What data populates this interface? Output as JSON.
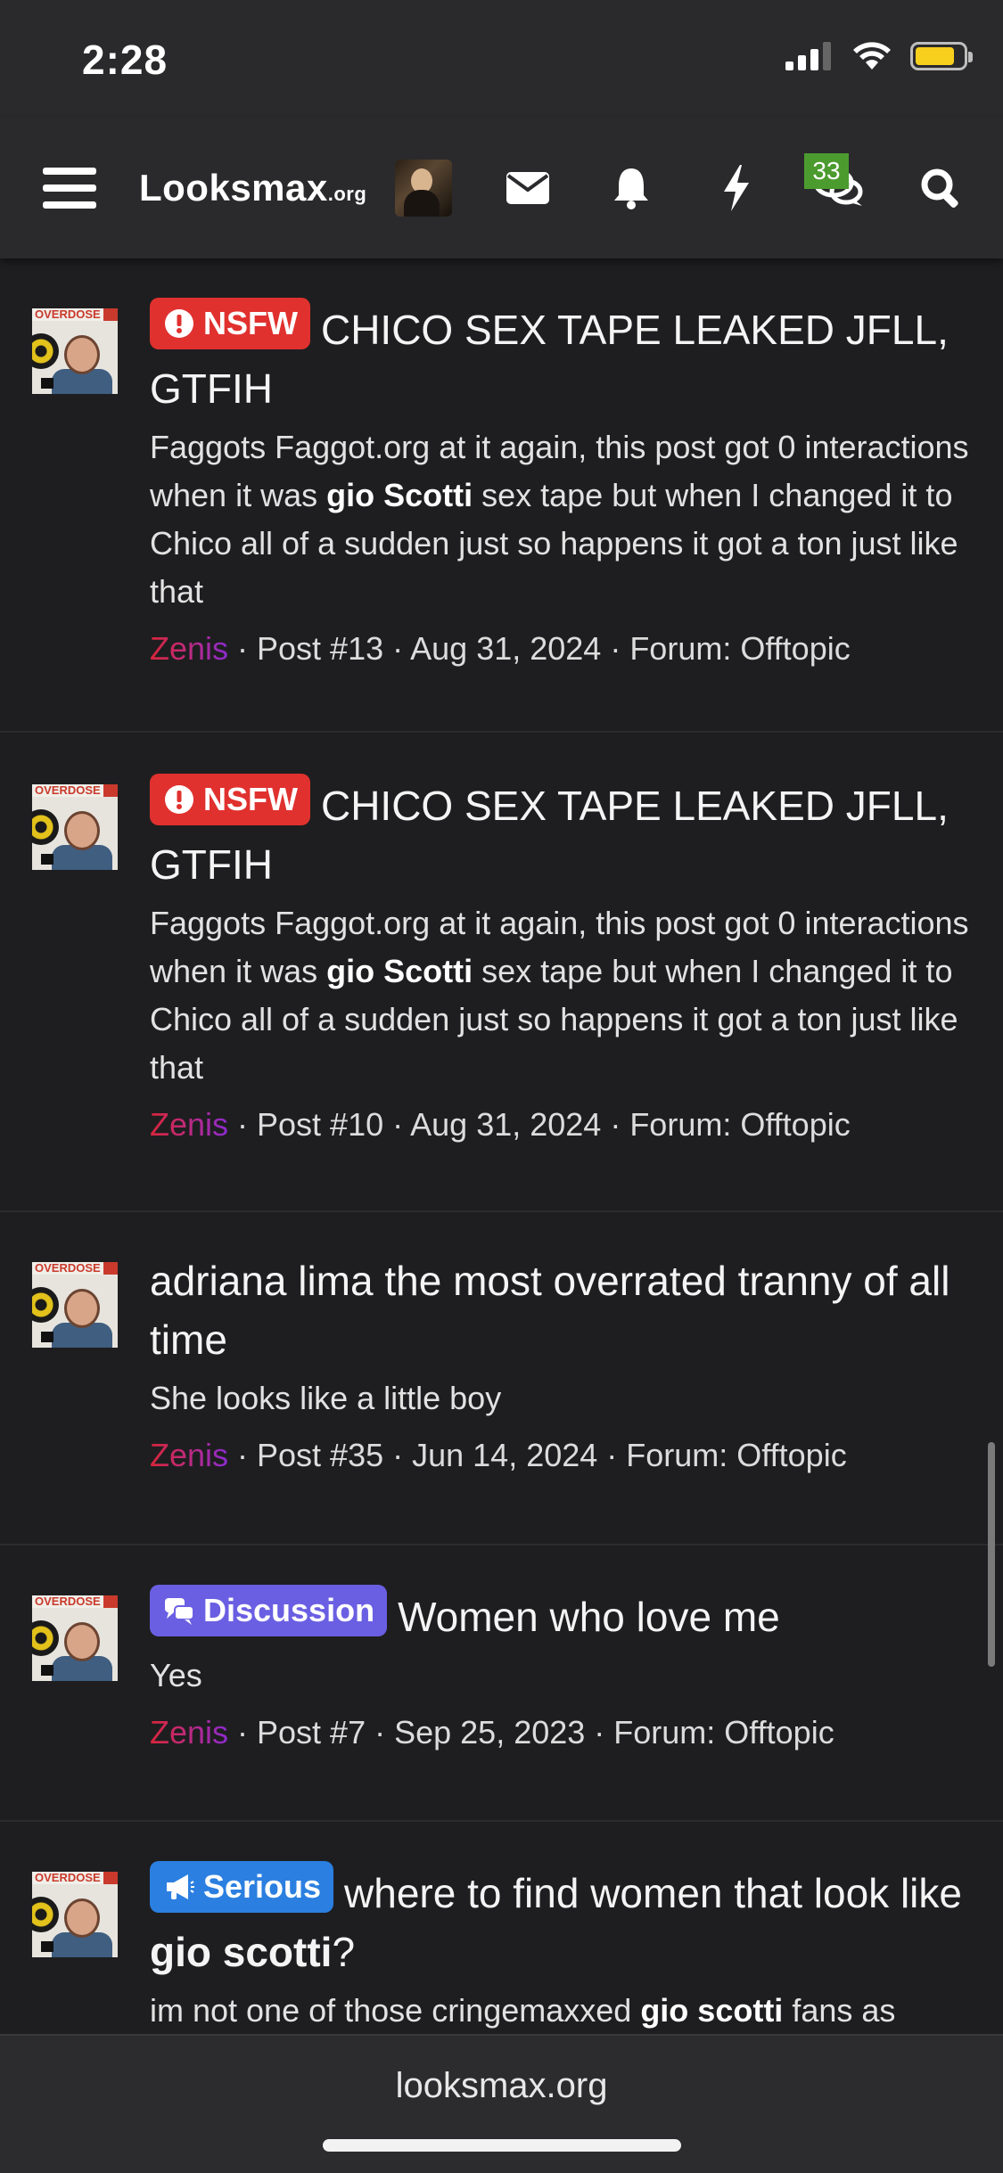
{
  "status_bar": {
    "time": "2:28",
    "battery_level": 0.85,
    "icons": [
      "cellular-icon",
      "wifi-icon",
      "battery-icon"
    ]
  },
  "nav": {
    "logo_main": "Looksmax",
    "logo_suffix": ".org",
    "messages_badge": "33",
    "icons": [
      "menu-icon",
      "avatar",
      "mail-icon",
      "bell-icon",
      "lightning-icon",
      "messages-icon",
      "search-icon"
    ]
  },
  "results": [
    {
      "badge": "NSFW",
      "title": "CHICO SEX TAPE LEAKED JFLL, GTFIH",
      "snippet_parts": [
        "Faggots Faggot.org at it again, this post got 0 interactions when it was ",
        "gio Scotti",
        " sex tape but when I changed it to Chico all of a sudden just so happens it got a ton just like that"
      ],
      "user": "Zenis",
      "meta": " · Post #13 · Aug 31, 2024 · Forum: Offtopic",
      "avatar_label": "OVERDOSE"
    },
    {
      "badge": "NSFW",
      "title": "CHICO SEX TAPE LEAKED JFLL, GTFIH",
      "snippet_parts": [
        "Faggots Faggot.org at it again, this post got 0 interactions when it was ",
        "gio Scotti",
        " sex tape but when I changed it to Chico all of a sudden just so happens it got a ton just like that"
      ],
      "user": "Zenis",
      "meta": " · Post #10 · Aug 31, 2024 · Forum: Offtopic",
      "avatar_label": "OVERDOSE"
    },
    {
      "title": "adriana lima the most overrated tranny of all time",
      "snippet": "She looks like a little boy",
      "user": "Zenis",
      "meta": " · Post #35 · Jun 14, 2024 · Forum: Offtopic",
      "avatar_label": "OVERDOSE"
    },
    {
      "badge": "Discussion",
      "title": "Women who love me",
      "snippet": "Yes",
      "user": "Zenis",
      "meta": " · Post #7 · Sep 25, 2023 · Forum: Offtopic",
      "avatar_label": "OVERDOSE"
    },
    {
      "badge": "Serious",
      "title_parts": [
        "where to find women that look like ",
        "gio scotti",
        "?"
      ],
      "snippet_parts": [
        "im not one of those cringemaxxed ",
        "gio scotti",
        " fans as"
      ],
      "avatar_label": "OVERDOSE"
    }
  ],
  "bottom_bar": {
    "url": "looksmax.org"
  },
  "colors": {
    "background": "#1e1e20",
    "header": "#2a2a2c",
    "nsfw_badge": "#e0312f",
    "discussion_badge": "#6a5fe2",
    "serious_badge": "#2b7fe0",
    "messages_badge": "#4c9b2f",
    "username_gradient": [
      "#d8253b",
      "#8b2ad0"
    ]
  }
}
